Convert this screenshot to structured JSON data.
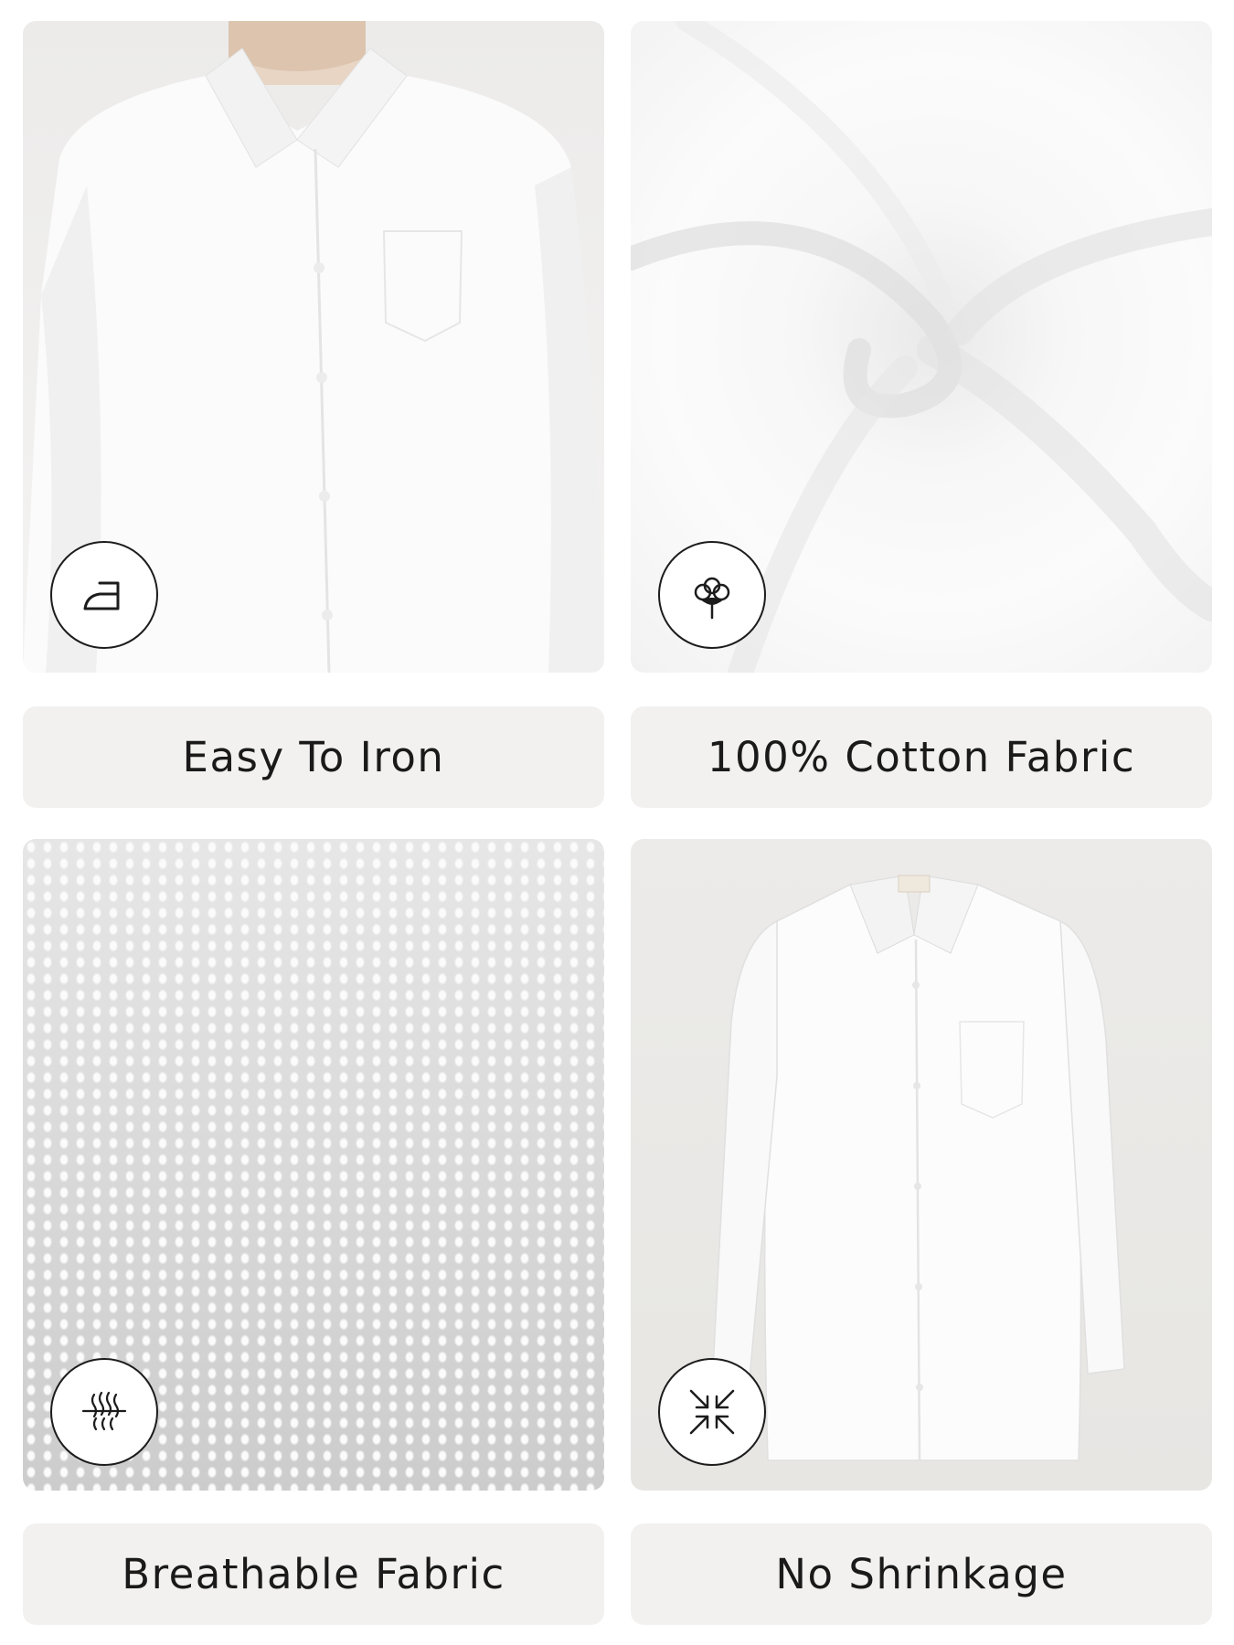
{
  "features": [
    {
      "label": "Easy To Iron",
      "icon": "iron-icon"
    },
    {
      "label": "100% Cotton Fabric",
      "icon": "cotton-icon"
    },
    {
      "label": "Breathable Fabric",
      "icon": "breathable-icon"
    },
    {
      "label": "No Shrinkage",
      "icon": "no-shrinkage-icon"
    }
  ],
  "colors": {
    "label_background": "#f2f1ef",
    "text": "#1a1a1a",
    "icon_stroke": "#1c1c1c"
  }
}
